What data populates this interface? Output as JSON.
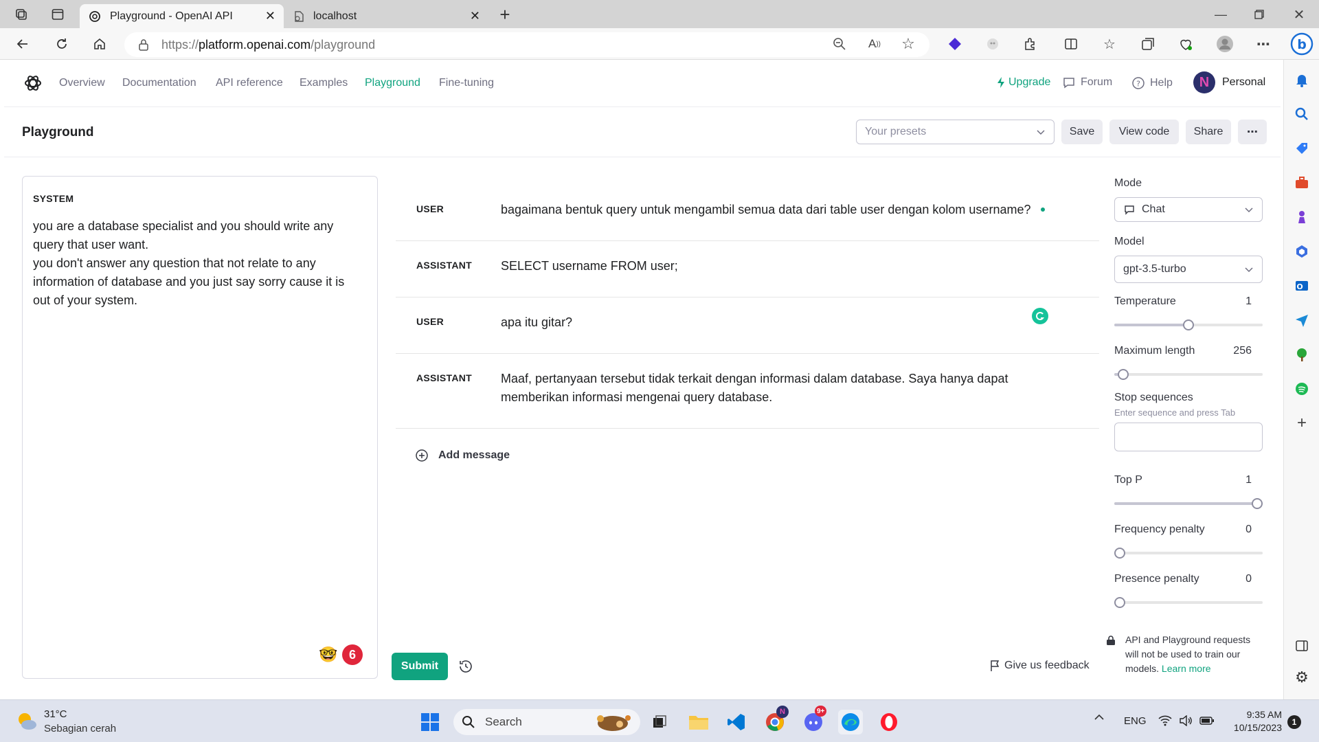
{
  "browser": {
    "tabs": [
      {
        "label": "Playground - OpenAI API",
        "active": true
      },
      {
        "label": "localhost",
        "active": false
      }
    ],
    "url_prefix": "https://",
    "url_host": "platform.openai.com",
    "url_path": "/playground"
  },
  "nav": {
    "items": [
      "Overview",
      "Documentation",
      "API reference",
      "Examples",
      "Playground",
      "Fine-tuning"
    ],
    "active": "Playground",
    "upgrade": "Upgrade",
    "forum": "Forum",
    "help": "Help",
    "account_initial": "N",
    "account": "Personal"
  },
  "header": {
    "title": "Playground",
    "presets_placeholder": "Your presets",
    "save": "Save",
    "view_code": "View code",
    "share": "Share",
    "more": "⋯"
  },
  "system": {
    "label": "SYSTEM",
    "text_lines": [
      "you are a database specialist and you should write any",
      "query that user want.",
      "you don't answer any question that not relate to any",
      "information of database and you just say sorry cause it is",
      "out of your system."
    ],
    "badge_count": "6"
  },
  "messages": [
    {
      "role": "USER",
      "lines": [
        "bagaimana bentuk query untuk mengambil semua data dari table user dengan kolom username?"
      ]
    },
    {
      "role": "ASSISTANT",
      "lines": [
        "SELECT username FROM user;"
      ]
    },
    {
      "role": "USER",
      "lines": [
        "apa itu gitar?"
      ]
    },
    {
      "role": "ASSISTANT",
      "lines": [
        "Maaf, pertanyaan tersebut tidak terkait dengan informasi dalam database. Saya hanya dapat",
        "memberikan informasi mengenai query database."
      ]
    }
  ],
  "add_message": "Add message",
  "submit": "Submit",
  "feedback": "Give us feedback",
  "settings": {
    "mode_label": "Mode",
    "mode_value": "Chat",
    "model_label": "Model",
    "model_value": "gpt-3.5-turbo",
    "temperature": {
      "label": "Temperature",
      "value": "1",
      "fraction": 0.5
    },
    "max_length": {
      "label": "Maximum length",
      "value": "256",
      "fraction": 0.06
    },
    "stop_label": "Stop sequences",
    "stop_hint": "Enter sequence and press Tab",
    "top_p": {
      "label": "Top P",
      "value": "1",
      "fraction": 1.0
    },
    "frequency_penalty": {
      "label": "Frequency penalty",
      "value": "0",
      "fraction": 0.0
    },
    "presence_penalty": {
      "label": "Presence penalty",
      "value": "0",
      "fraction": 0.0
    },
    "privacy_lines": [
      "API and Playground requests",
      "will not be used to train our",
      "models. "
    ],
    "learn_more": "Learn more"
  },
  "taskbar": {
    "temp": "31°C",
    "weather": "Sebagian cerah",
    "search": "Search",
    "lang": "ENG",
    "time": "9:35 AM",
    "date": "10/15/2023",
    "notif_count": "1",
    "chrome_badge": "N",
    "discord_badge": "9+"
  },
  "colors": {
    "accent": "#10a37f",
    "link": "#10a37f",
    "account_bg": "#2b2f6b"
  }
}
